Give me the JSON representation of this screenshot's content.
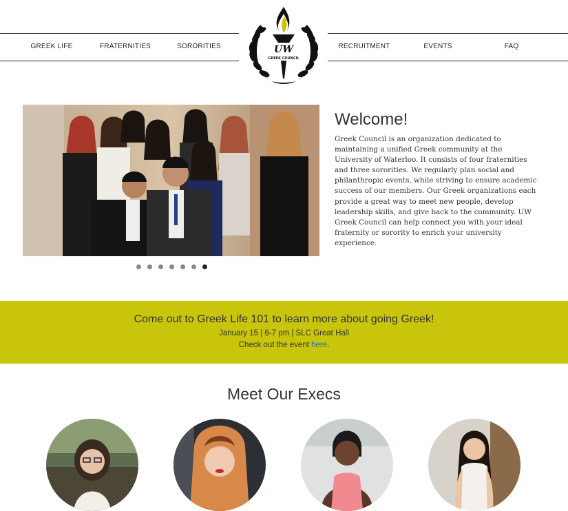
{
  "nav": {
    "left": [
      "GREEK LIFE",
      "FRATERNITIES",
      "SORORITIES"
    ],
    "right": [
      "RECRUITMENT",
      "EVENTS",
      "FAQ"
    ]
  },
  "logo": {
    "line1": "UW",
    "line2": "GREEK COUNCIL"
  },
  "hero": {
    "slide_count": 7,
    "active_slide": 7
  },
  "welcome": {
    "title": "Welcome!",
    "body": "Greek Council is an organization dedicated to maintaining a unified Greek community at the University of Waterloo. It consists of four fraternities and three sororities. We regularly plan social and philanthropic events, while striving to ensure academic success of our members. Our Greek organizations each provide a great way to meet new people, develop leadership skills, and give back to the community. UW Greek Council can help connect you with your ideal fraternity or sorority to enrich your university experience."
  },
  "banner": {
    "headline": "Come out to Greek Life 101 to learn more about going Greek!",
    "details": "January 15 | 6-7 pm | SLC Great Hall",
    "cta_prefix": "Check out the event ",
    "cta_link": "here",
    "cta_suffix": ".",
    "color": "#c9c50a"
  },
  "execs": {
    "title": "Meet Our Execs",
    "count": 4
  },
  "colors": {
    "accent": "#c9c50a",
    "link": "#1f6fb2",
    "text": "#333333"
  }
}
